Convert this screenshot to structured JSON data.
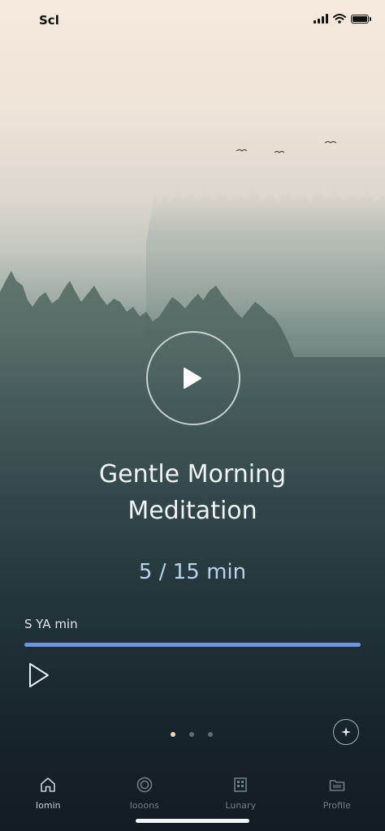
{
  "status_bar": {
    "time": "Scl",
    "icons": [
      "cellular-signal-icon",
      "wifi-icon",
      "battery-icon"
    ]
  },
  "player": {
    "title_line1": "Gentle Morning",
    "title_line2": "Meditation",
    "duration": "5 / 15 min",
    "elapsed_label": "S YA min",
    "progress": 1.0,
    "play_icon": "play-icon",
    "favorite_icon": "sparkle-icon"
  },
  "pager": {
    "count": 3,
    "active_index": 0
  },
  "tab_bar": {
    "items": [
      {
        "label": "Iomin",
        "icon": "home-icon",
        "active": true
      },
      {
        "label": "Iooons",
        "icon": "circle-target-icon",
        "active": false
      },
      {
        "label": "Lunary",
        "icon": "library-icon",
        "active": false
      },
      {
        "label": "Profile",
        "icon": "folder-icon",
        "active": false
      }
    ]
  },
  "colors": {
    "accent": "#6f95de",
    "duration_text": "#b9d3ea",
    "active_dot": "#f3d6b6",
    "inactive_tab": "#6f7d85"
  }
}
